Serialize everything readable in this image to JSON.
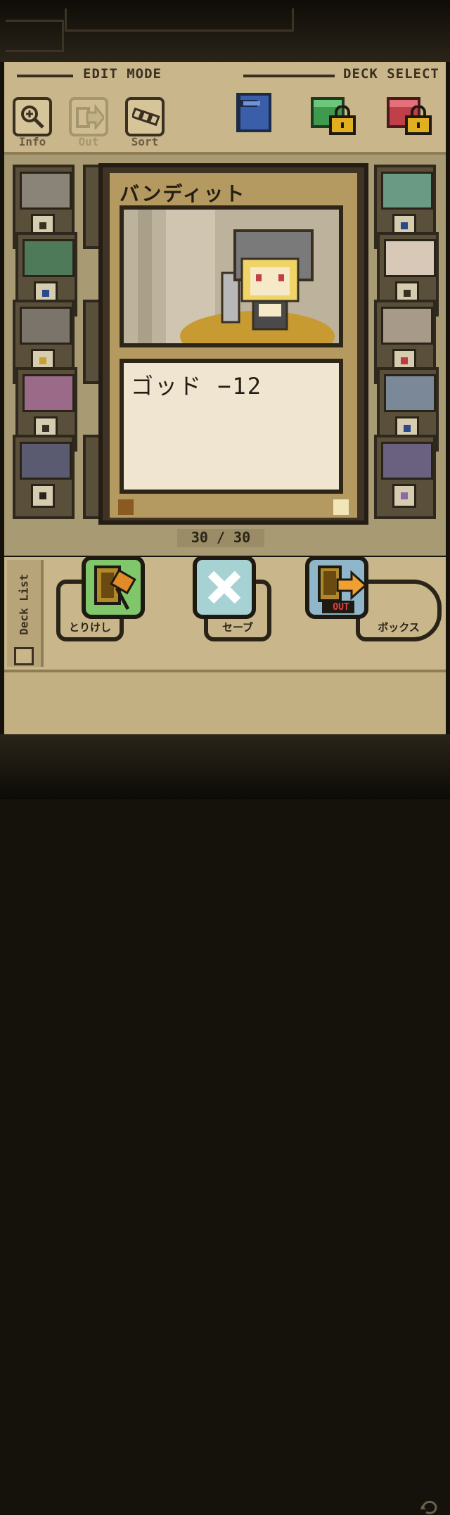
{
  "header": {
    "edit_mode_label": "EDIT MODE",
    "deck_select_label": "DECK SELECT",
    "tools": [
      {
        "label": "Info",
        "icon": "magnifier-plus-icon",
        "enabled": true
      },
      {
        "label": "Out",
        "icon": "arrow-out-icon",
        "enabled": false
      },
      {
        "label": "Sort",
        "icon": "sort-cards-icon",
        "enabled": true
      }
    ],
    "decks": [
      {
        "color": "#3a5fa8",
        "locked": false
      },
      {
        "color": "#3f9a4e",
        "locked": true
      },
      {
        "color": "#c0404a",
        "locked": true
      }
    ]
  },
  "selected_card": {
    "name": "バンディット",
    "description": "ゴッド −12"
  },
  "deck_counter": {
    "current": "30",
    "max": "30",
    "text": "30 / 30"
  },
  "left_cards": [
    "ghost-icon",
    "shield-blue-icon",
    "dark-icon",
    "ghost-icon",
    "coin-icon"
  ],
  "right_cards": [
    "ghost-icon",
    "dark-icon",
    "gem-icon",
    "ring-icon",
    "flower-icon"
  ],
  "actions": {
    "deck_list_label": "Deck List",
    "buttons": [
      {
        "tab_label": "とりけし",
        "icon": "hammer-card-icon",
        "color": "#7fc76a"
      },
      {
        "tab_label": "セーブ",
        "icon": "close-x-icon",
        "color": "#a6d2d3"
      },
      {
        "tab_label": "ボックス",
        "icon": "card-out-icon",
        "color": "#8fb7c9",
        "badge": "OUT"
      }
    ]
  },
  "colors": {
    "panel": "#c9b68a",
    "board": "#a89a72",
    "card_frame": "#3e3325"
  }
}
